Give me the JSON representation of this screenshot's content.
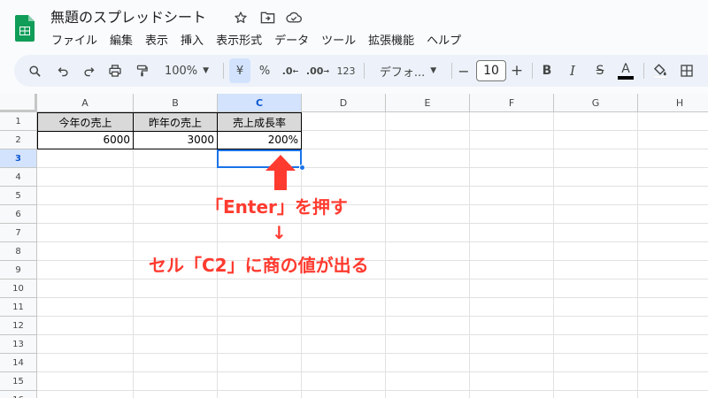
{
  "app": {
    "doc_title": "無題のスプレッドシート",
    "icons": [
      "star-icon",
      "move-to-folder-icon",
      "cloud-saved-icon"
    ]
  },
  "menu": [
    "ファイル",
    "編集",
    "表示",
    "挿入",
    "表示形式",
    "データ",
    "ツール",
    "拡張機能",
    "ヘルプ"
  ],
  "toolbar": {
    "zoom": "100%",
    "currency": "¥",
    "percent": "%",
    "decrease_decimal": ".0",
    "increase_decimal": ".00",
    "number_format": "123",
    "font": "デフォ...",
    "font_size": "10",
    "minus": "−",
    "plus": "+",
    "bold": "B",
    "italic": "I",
    "strike": "S",
    "text_color": "A"
  },
  "sheet": {
    "columns": [
      "A",
      "B",
      "C",
      "D",
      "E",
      "F",
      "G",
      "H"
    ],
    "rows": [
      "1",
      "2",
      "3",
      "4",
      "5",
      "6",
      "7",
      "8",
      "9",
      "10",
      "11",
      "12",
      "13",
      "14",
      "15",
      "16",
      "17"
    ],
    "active_cell": "C3",
    "cells": {
      "A1": "今年の売上",
      "B1": "昨年の売上",
      "C1": "売上成長率",
      "A2": "6000",
      "B2": "3000",
      "C2": "200%"
    }
  },
  "annotations": {
    "step1": "「Enter」を押す",
    "arrow": "↓",
    "step2": "セル「C2」に商の値が出る"
  },
  "colors": {
    "annotation": "#ff3b30",
    "selection": "#1a73e8",
    "header_fill": "#d9d9d9",
    "logo": "#0f9d58"
  }
}
